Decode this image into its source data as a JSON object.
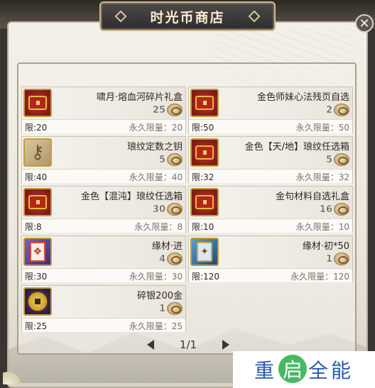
{
  "window": {
    "title": "时光币商店"
  },
  "items": [
    {
      "name": "啸月·熔血河碎片礼盒",
      "price": "25",
      "limit": "限:20",
      "perm_limit": "永久限量：20",
      "icon": "chest-icon"
    },
    {
      "name": "金色师妹心法残页自选",
      "price": "2",
      "limit": "限:50",
      "perm_limit": "永久限量：50",
      "icon": "chest-icon"
    },
    {
      "name": "琅纹定数之钥",
      "price": "5",
      "limit": "限:40",
      "perm_limit": "永久限量：40",
      "icon": "key-icon"
    },
    {
      "name": "金色【天/地】琅纹任选箱",
      "price": "5",
      "limit": "限:32",
      "perm_limit": "永久限量：32",
      "icon": "chest-icon"
    },
    {
      "name": "金色【混沌】琅纹任选箱",
      "price": "30",
      "limit": "限:8",
      "perm_limit": "永久限量：8",
      "icon": "chest-icon"
    },
    {
      "name": "金句材料自选礼盒",
      "price": "16",
      "limit": "限:10",
      "perm_limit": "永久限量：10",
      "icon": "chest-icon"
    },
    {
      "name": "缘材·进",
      "price": "4",
      "limit": "限:30",
      "perm_limit": "永久限量：30",
      "icon": "card-icon"
    },
    {
      "name": "缘材·初*50",
      "price": "1",
      "limit": "限:120",
      "perm_limit": "永久限量：120",
      "icon": "card-icon"
    },
    {
      "name": "碎银200金",
      "price": "1",
      "limit": "限:25",
      "perm_limit": "永久限量：25",
      "icon": "coin-icon"
    }
  ],
  "pager": {
    "text": "1/1"
  },
  "watermark": {
    "left": "重",
    "middle": "启",
    "right": "全能"
  },
  "colors": {
    "accent": "#c79a3a",
    "banner": "#3a3838",
    "watermark_blue": "#2a5aa8",
    "watermark_green": "#3db55a"
  }
}
